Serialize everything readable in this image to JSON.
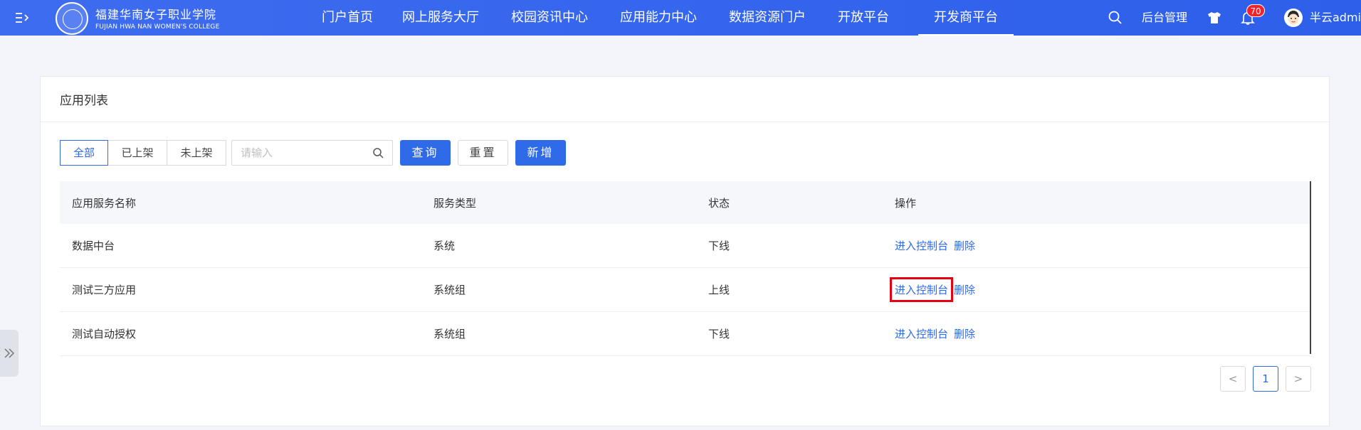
{
  "header": {
    "logo": {
      "cn": "福建华南女子职业学院",
      "en": "FUJIAN HWA NAN WOMEN'S COLLEGE"
    },
    "nav": [
      "门户首页",
      "网上服务大厅",
      "校园资讯中心",
      "应用能力中心",
      "数据资源门户",
      "开放平台",
      "开发商平台"
    ],
    "active_nav": "开发商平台",
    "admin_link": "后台管理",
    "notification_count": "70",
    "username": "半云admin",
    "icons": [
      "menu-fold-icon",
      "search-icon",
      "shirt-icon",
      "bell-icon",
      "avatar"
    ]
  },
  "card": {
    "title": "应用列表",
    "filters": [
      "全部",
      "已上架",
      "未上架"
    ],
    "active_filter": "全部",
    "search": {
      "placeholder": "请输入",
      "value": ""
    },
    "buttons": {
      "query": "查询",
      "reset": "重置",
      "add": "新增"
    },
    "table": {
      "columns": [
        "应用服务名称",
        "服务类型",
        "状态",
        "操作"
      ],
      "rows": [
        {
          "name": "数据中台",
          "type": "系统",
          "status": "下线",
          "actions": [
            "进入控制台",
            "删除"
          ]
        },
        {
          "name": "测试三方应用",
          "type": "系统组",
          "status": "上线",
          "actions": [
            "进入控制台",
            "删除"
          ]
        },
        {
          "name": "测试自动授权",
          "type": "系统组",
          "status": "下线",
          "actions": [
            "进入控制台",
            "删除"
          ]
        }
      ]
    },
    "pagination": {
      "prev": "<",
      "current": "1",
      "next": ">"
    }
  },
  "colors": {
    "header": "#3e6cf0",
    "primary": "#2f6ae8",
    "badge": "#f5222d",
    "highlight": "#e60012"
  }
}
